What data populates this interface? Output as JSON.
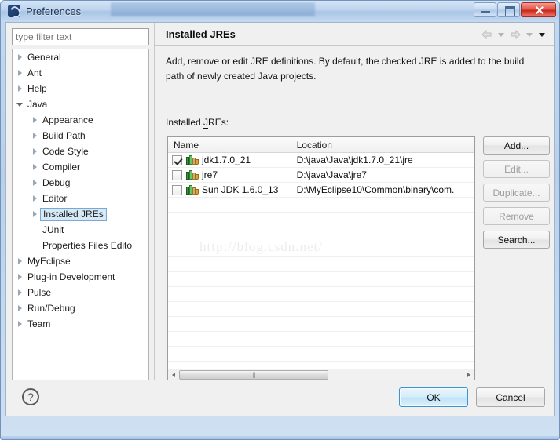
{
  "window": {
    "title": "Preferences",
    "app_icon": "eclipse-icon",
    "controls": {
      "minimize": "minimize-button",
      "maximize": "maximize-button",
      "close": "close-button"
    }
  },
  "sidebar": {
    "filter": {
      "value": "",
      "placeholder": "type filter text"
    },
    "items": [
      {
        "label": "General",
        "indent": 0,
        "state": "closed",
        "selected": false
      },
      {
        "label": "Ant",
        "indent": 0,
        "state": "closed",
        "selected": false
      },
      {
        "label": "Help",
        "indent": 0,
        "state": "closed",
        "selected": false
      },
      {
        "label": "Java",
        "indent": 0,
        "state": "open",
        "selected": false
      },
      {
        "label": "Appearance",
        "indent": 1,
        "state": "closed",
        "selected": false
      },
      {
        "label": "Build Path",
        "indent": 1,
        "state": "closed",
        "selected": false
      },
      {
        "label": "Code Style",
        "indent": 1,
        "state": "closed",
        "selected": false
      },
      {
        "label": "Compiler",
        "indent": 1,
        "state": "closed",
        "selected": false
      },
      {
        "label": "Debug",
        "indent": 1,
        "state": "closed",
        "selected": false
      },
      {
        "label": "Editor",
        "indent": 1,
        "state": "closed",
        "selected": false
      },
      {
        "label": "Installed JREs",
        "indent": 1,
        "state": "closed",
        "selected": true
      },
      {
        "label": "JUnit",
        "indent": 1,
        "state": "leaf",
        "selected": false
      },
      {
        "label": "Properties Files Edito",
        "indent": 1,
        "state": "leaf",
        "selected": false
      },
      {
        "label": "MyEclipse",
        "indent": 0,
        "state": "closed",
        "selected": false
      },
      {
        "label": "Plug-in Development",
        "indent": 0,
        "state": "closed",
        "selected": false
      },
      {
        "label": "Pulse",
        "indent": 0,
        "state": "closed",
        "selected": false
      },
      {
        "label": "Run/Debug",
        "indent": 0,
        "state": "closed",
        "selected": false
      },
      {
        "label": "Team",
        "indent": 0,
        "state": "closed",
        "selected": false
      }
    ]
  },
  "content": {
    "page_title": "Installed JREs",
    "description": "Add, remove or edit JRE definitions. By default, the checked JRE is added to the build path of newly created Java projects.",
    "list_label": "Installed JREs:",
    "nav": {
      "back_icon": "back-arrow-icon",
      "back_menu_icon": "chevron-down-icon",
      "forward_icon": "forward-arrow-icon",
      "forward_menu_icon": "chevron-down-icon",
      "view_menu_icon": "chevron-down-icon"
    },
    "table": {
      "columns": [
        "Name",
        "Location"
      ],
      "rows": [
        {
          "checked": true,
          "name": "jdk1.7.0_21",
          "location": "D:\\java\\Java\\jdk1.7.0_21\\jre"
        },
        {
          "checked": false,
          "name": "jre7",
          "location": "D:\\java\\Java\\jre7"
        },
        {
          "checked": false,
          "name": "Sun JDK 1.6.0_13",
          "location": "D:\\MyEclipse10\\Common\\binary\\com."
        }
      ],
      "watermark": "http://blog.csdn.net/"
    },
    "side_buttons": [
      {
        "label": "Add...",
        "accel": "A",
        "enabled": true
      },
      {
        "label": "Edit...",
        "accel": "E",
        "enabled": false
      },
      {
        "label": "Duplicate...",
        "accel": "c",
        "enabled": false
      },
      {
        "label": "Remove",
        "accel": "R",
        "enabled": false
      },
      {
        "label": "Search...",
        "accel": "S",
        "enabled": true
      }
    ]
  },
  "footer": {
    "help_icon": "question-mark-icon",
    "ok_label": "OK",
    "cancel_label": "Cancel"
  },
  "colors": {
    "titlebar": "#bdd2ec",
    "close_button": "#c9271b",
    "selection": "#d5e9f7",
    "default_button": "#bde3f8",
    "dialog_bg": "#f0f0f0"
  }
}
